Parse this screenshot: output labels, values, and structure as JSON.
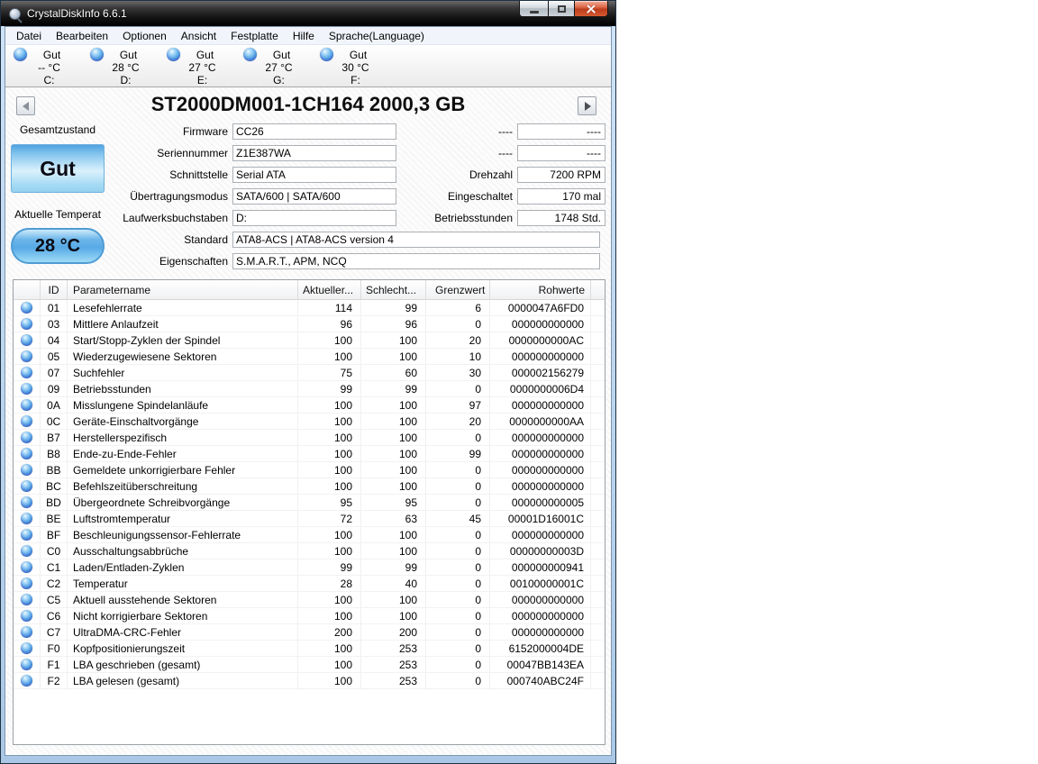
{
  "window": {
    "title": "CrystalDiskInfo 6.6.1"
  },
  "menu": {
    "items": [
      "Datei",
      "Bearbeiten",
      "Optionen",
      "Ansicht",
      "Festplatte",
      "Hilfe",
      "Sprache(Language)"
    ]
  },
  "disk_tabs": [
    {
      "status": "Gut",
      "temp": "-- °C",
      "letter": "C:",
      "selected": false
    },
    {
      "status": "Gut",
      "temp": "28 °C",
      "letter": "D:",
      "selected": true
    },
    {
      "status": "Gut",
      "temp": "27 °C",
      "letter": "E:",
      "selected": false
    },
    {
      "status": "Gut",
      "temp": "27 °C",
      "letter": "G:",
      "selected": false
    },
    {
      "status": "Gut",
      "temp": "30 °C",
      "letter": "F:",
      "selected": false
    }
  ],
  "nav": {
    "title": "ST2000DM001-1CH164 2000,3 GB"
  },
  "health": {
    "condition_label": "Gesamtzustand",
    "condition_value": "Gut",
    "temperature_label": "Aktuelle Temperat",
    "temperature_value": "28 °C"
  },
  "fields": {
    "left": [
      {
        "label": "Firmware",
        "value": "CC26"
      },
      {
        "label": "Seriennummer",
        "value": "Z1E387WA"
      },
      {
        "label": "Schnittstelle",
        "value": "Serial ATA"
      },
      {
        "label": "Übertragungsmodus",
        "value": "SATA/600 | SATA/600"
      },
      {
        "label": "Laufwerksbuchstaben",
        "value": "D:"
      }
    ],
    "right": [
      {
        "label": "----",
        "value": "----"
      },
      {
        "label": "----",
        "value": "----"
      },
      {
        "label": "Drehzahl",
        "value": "7200 RPM"
      },
      {
        "label": "Eingeschaltet",
        "value": "170 mal"
      },
      {
        "label": "Betriebsstunden",
        "value": "1748 Std."
      }
    ],
    "wide": [
      {
        "label": "Standard",
        "value": "ATA8-ACS | ATA8-ACS version 4"
      },
      {
        "label": "Eigenschaften",
        "value": "S.M.A.R.T., APM, NCQ"
      }
    ]
  },
  "smart_table": {
    "headers": [
      "ID",
      "Parametername",
      "Aktueller...",
      "Schlecht...",
      "Grenzwert",
      "Rohwerte"
    ],
    "rows": [
      {
        "id": "01",
        "name": "Lesefehlerrate",
        "current": "114",
        "worst": "99",
        "threshold": "6",
        "raw": "0000047A6FD0"
      },
      {
        "id": "03",
        "name": "Mittlere Anlaufzeit",
        "current": "96",
        "worst": "96",
        "threshold": "0",
        "raw": "000000000000"
      },
      {
        "id": "04",
        "name": "Start/Stopp-Zyklen der Spindel",
        "current": "100",
        "worst": "100",
        "threshold": "20",
        "raw": "0000000000AC"
      },
      {
        "id": "05",
        "name": "Wiederzugewiesene Sektoren",
        "current": "100",
        "worst": "100",
        "threshold": "10",
        "raw": "000000000000"
      },
      {
        "id": "07",
        "name": "Suchfehler",
        "current": "75",
        "worst": "60",
        "threshold": "30",
        "raw": "000002156279"
      },
      {
        "id": "09",
        "name": "Betriebsstunden",
        "current": "99",
        "worst": "99",
        "threshold": "0",
        "raw": "0000000006D4"
      },
      {
        "id": "0A",
        "name": "Misslungene Spindelanläufe",
        "current": "100",
        "worst": "100",
        "threshold": "97",
        "raw": "000000000000"
      },
      {
        "id": "0C",
        "name": "Geräte-Einschaltvorgänge",
        "current": "100",
        "worst": "100",
        "threshold": "20",
        "raw": "0000000000AA"
      },
      {
        "id": "B7",
        "name": "Herstellerspezifisch",
        "current": "100",
        "worst": "100",
        "threshold": "0",
        "raw": "000000000000"
      },
      {
        "id": "B8",
        "name": "Ende-zu-Ende-Fehler",
        "current": "100",
        "worst": "100",
        "threshold": "99",
        "raw": "000000000000"
      },
      {
        "id": "BB",
        "name": "Gemeldete unkorrigierbare Fehler",
        "current": "100",
        "worst": "100",
        "threshold": "0",
        "raw": "000000000000"
      },
      {
        "id": "BC",
        "name": "Befehlszeitüberschreitung",
        "current": "100",
        "worst": "100",
        "threshold": "0",
        "raw": "000000000000"
      },
      {
        "id": "BD",
        "name": "Übergeordnete Schreibvorgänge",
        "current": "95",
        "worst": "95",
        "threshold": "0",
        "raw": "000000000005"
      },
      {
        "id": "BE",
        "name": "Luftstromtemperatur",
        "current": "72",
        "worst": "63",
        "threshold": "45",
        "raw": "00001D16001C"
      },
      {
        "id": "BF",
        "name": "Beschleunigungssensor-Fehlerrate",
        "current": "100",
        "worst": "100",
        "threshold": "0",
        "raw": "000000000000"
      },
      {
        "id": "C0",
        "name": "Ausschaltungsabbrüche",
        "current": "100",
        "worst": "100",
        "threshold": "0",
        "raw": "00000000003D"
      },
      {
        "id": "C1",
        "name": "Laden/Entladen-Zyklen",
        "current": "99",
        "worst": "99",
        "threshold": "0",
        "raw": "000000000941"
      },
      {
        "id": "C2",
        "name": "Temperatur",
        "current": "28",
        "worst": "40",
        "threshold": "0",
        "raw": "00100000001C"
      },
      {
        "id": "C5",
        "name": "Aktuell ausstehende Sektoren",
        "current": "100",
        "worst": "100",
        "threshold": "0",
        "raw": "000000000000"
      },
      {
        "id": "C6",
        "name": "Nicht korrigierbare Sektoren",
        "current": "100",
        "worst": "100",
        "threshold": "0",
        "raw": "000000000000"
      },
      {
        "id": "C7",
        "name": "UltraDMA-CRC-Fehler",
        "current": "200",
        "worst": "200",
        "threshold": "0",
        "raw": "000000000000"
      },
      {
        "id": "F0",
        "name": "Kopfpositionierungszeit",
        "current": "100",
        "worst": "253",
        "threshold": "0",
        "raw": "6152000004DE"
      },
      {
        "id": "F1",
        "name": "LBA geschrieben (gesamt)",
        "current": "100",
        "worst": "253",
        "threshold": "0",
        "raw": "00047BB143EA"
      },
      {
        "id": "F2",
        "name": "LBA gelesen (gesamt)",
        "current": "100",
        "worst": "253",
        "threshold": "0",
        "raw": "000740ABC24F"
      }
    ]
  },
  "colors": {
    "selected_tab_underline": "#3b2fd0",
    "health_good_blue": "#7fc2ee",
    "close_button_red": "#cf4a30",
    "status_orb_blue": "#57abe9"
  }
}
